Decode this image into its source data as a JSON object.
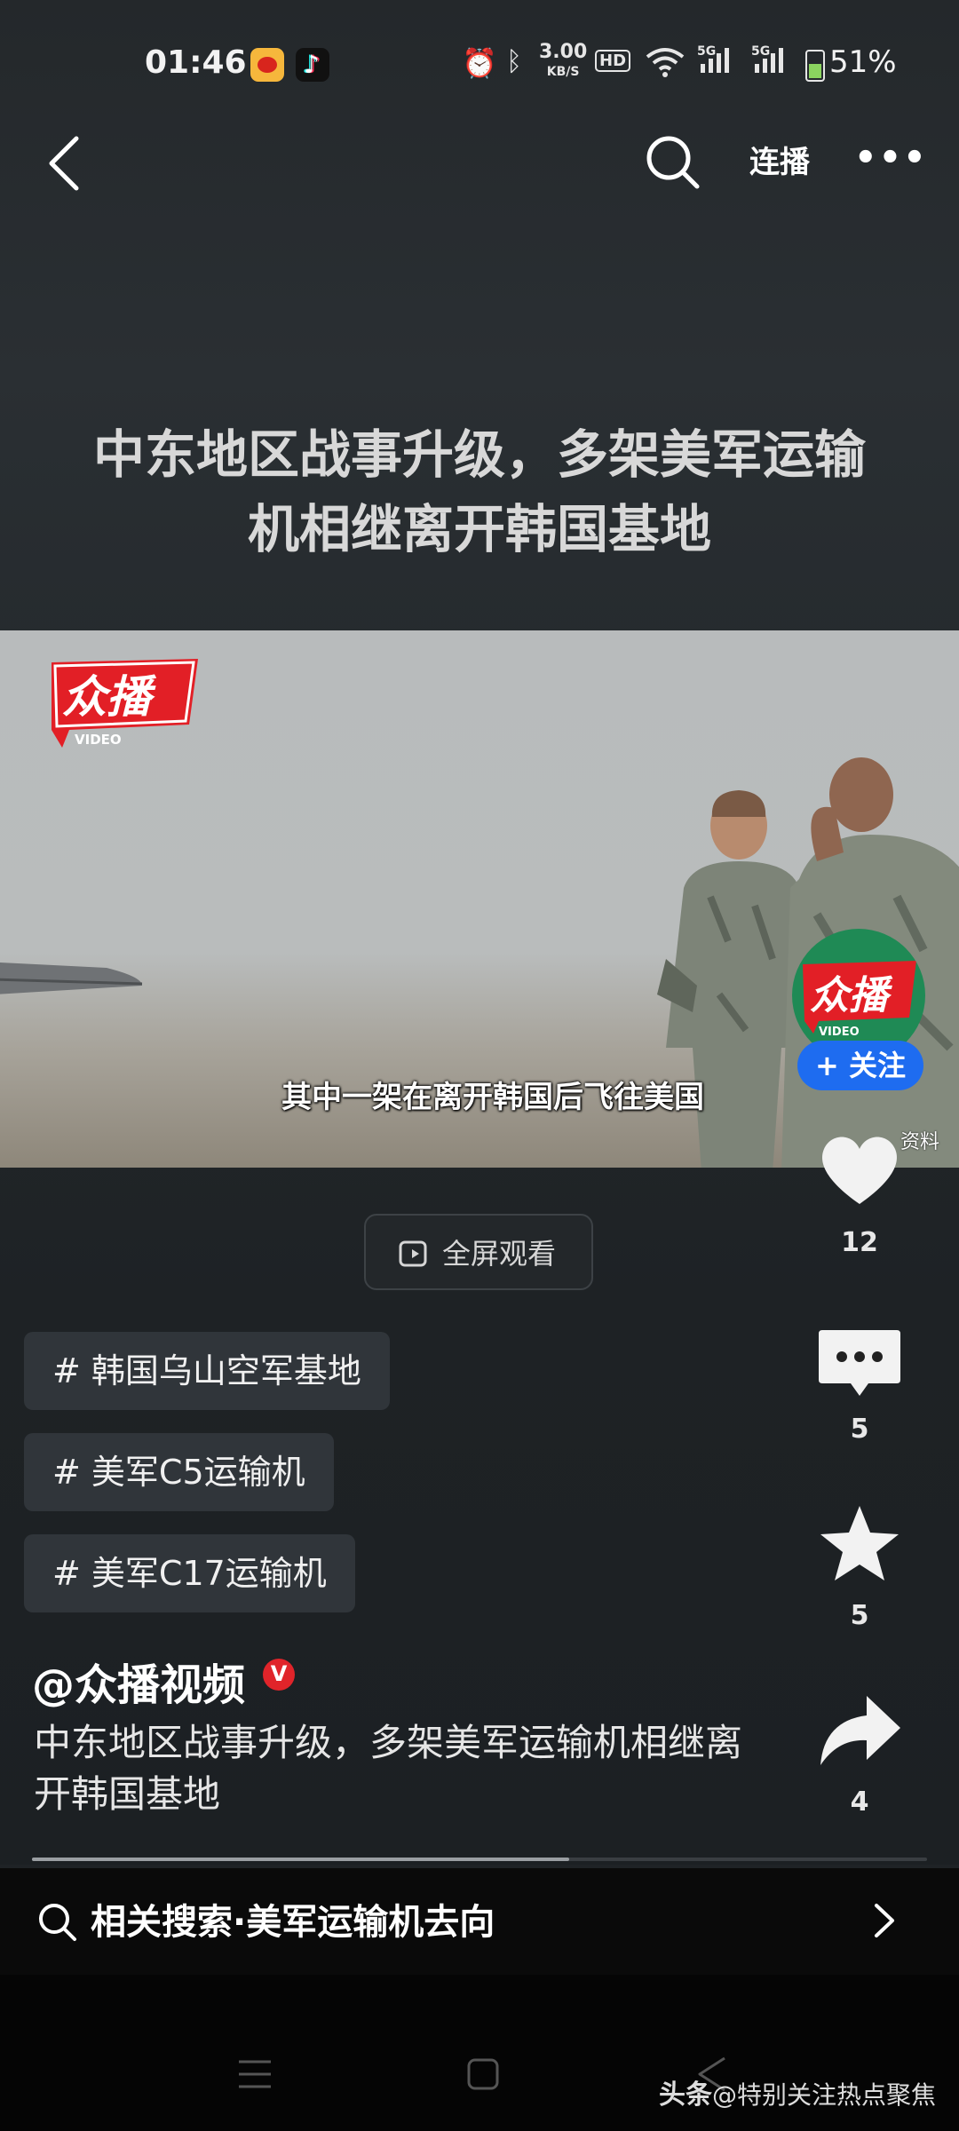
{
  "status_bar": {
    "time": "01:46",
    "apps": [
      "weibo-icon",
      "tiktok-icon"
    ],
    "net_speed": "3.00",
    "net_unit": "KB/S",
    "hd_label": "HD",
    "signal_labels": [
      "5G",
      "5G"
    ],
    "battery": "51%",
    "battery_level": 0.51
  },
  "nav": {
    "lianbo_label": "连播"
  },
  "video": {
    "title_line1": "中东地区战事升级，多架美军运输",
    "title_line2": "机相继离开韩国基地",
    "logo_text": "众播",
    "logo_sub": "VIDEO",
    "subtitle": "其中一架在离开韩国后飞往美国",
    "source_mark": "资料",
    "progress": 0.6
  },
  "channel": {
    "avatar_text": "众播",
    "avatar_sub": "VIDEO",
    "follow_label": "+ 关注"
  },
  "actions": {
    "likes": "12",
    "comments": "5",
    "favorites": "5",
    "shares": "4"
  },
  "fullscreen_label": "全屏观看",
  "tags": [
    "# 韩国乌山空军基地",
    "# 美军C5运输机",
    "# 美军C17运输机"
  ],
  "author": "@众播视频",
  "description": "中东地区战事升级，多架美军运输机相继离开韩国基地",
  "related_search": "相关搜索·美军运输机去向",
  "watermark": {
    "brand": "头条",
    "handle": "@特别关注热点聚焦"
  }
}
